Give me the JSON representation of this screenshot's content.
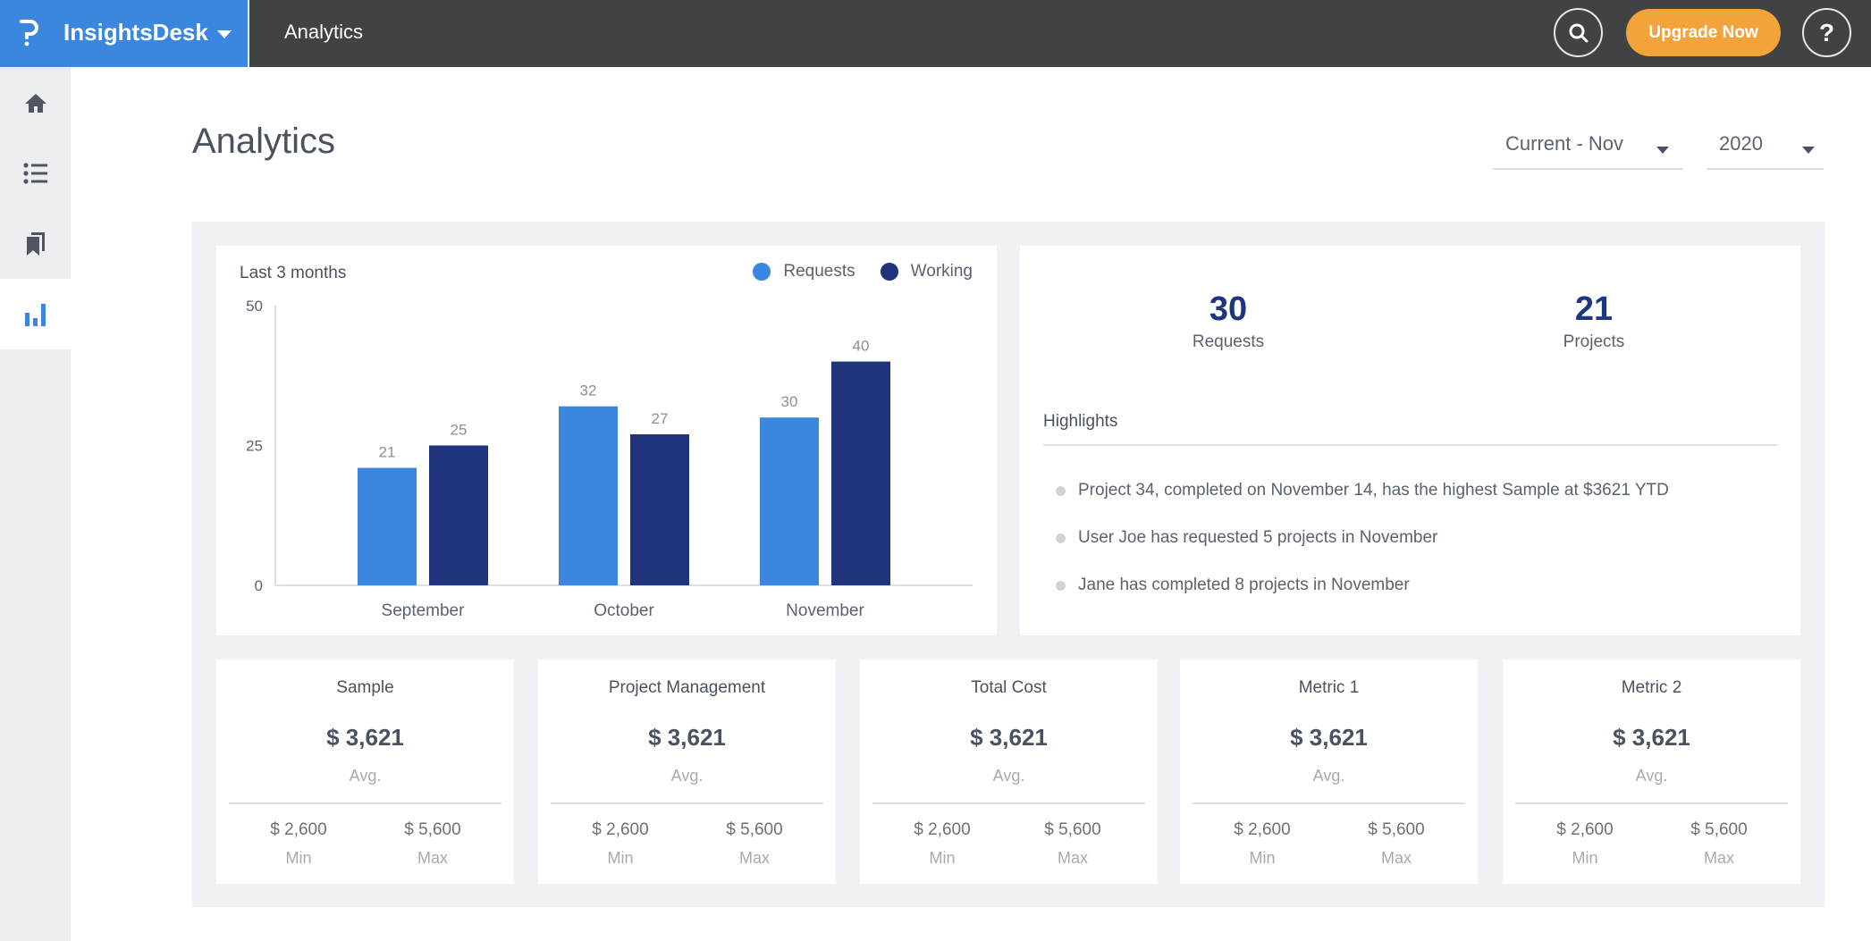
{
  "topbar": {
    "brand_name": "InsightsDesk",
    "section_title": "Analytics",
    "upgrade_label": "Upgrade Now",
    "help_label": "?",
    "icons": {
      "search": "search-icon",
      "help": "help-icon",
      "brand": "logo-icon",
      "brand_menu": "chevron-down-icon"
    }
  },
  "sidebar": {
    "items": [
      {
        "name": "home",
        "icon": "home-icon",
        "active": false
      },
      {
        "name": "list",
        "icon": "list-icon",
        "active": false
      },
      {
        "name": "bookmarks",
        "icon": "bookmarks-icon",
        "active": false
      },
      {
        "name": "analytics",
        "icon": "bar-chart-icon",
        "active": true
      }
    ]
  },
  "page": {
    "title": "Analytics",
    "period_select": {
      "value": "Current - Nov"
    },
    "year_select": {
      "value": "2020"
    }
  },
  "colors": {
    "brand": "#3b87e0",
    "topbar": "#414244",
    "upgrade": "#f2a43a",
    "requests": "#3b87e0",
    "working": "#1f347c",
    "stat_number": "#1f3580"
  },
  "chart_data": {
    "type": "bar",
    "title": "Last 3 months",
    "categories": [
      "September",
      "October",
      "November"
    ],
    "series": [
      {
        "name": "Requests",
        "color": "#3b87e0",
        "values": [
          21,
          32,
          30
        ]
      },
      {
        "name": "Working",
        "color": "#1f347c",
        "values": [
          25,
          27,
          40
        ]
      }
    ],
    "yticks": [
      0,
      25,
      50
    ],
    "ylim": [
      0,
      50
    ],
    "xlabel": "",
    "ylabel": "",
    "grid": false,
    "legend": "top-right"
  },
  "stats": [
    {
      "value": "30",
      "label": "Requests"
    },
    {
      "value": "21",
      "label": "Projects"
    }
  ],
  "highlights": {
    "title": "Highlights",
    "items": [
      "Project 34, completed on November 14, has the highest Sample at $3621 YTD",
      "User Joe has requested 5 projects in November",
      "Jane has completed 8 projects in November"
    ]
  },
  "metrics": [
    {
      "title": "Sample",
      "value": "$ 3,621",
      "avg_label": "Avg.",
      "min": "$ 2,600",
      "min_label": "Min",
      "max": "$ 5,600",
      "max_label": "Max"
    },
    {
      "title": "Project Management",
      "value": "$ 3,621",
      "avg_label": "Avg.",
      "min": "$ 2,600",
      "min_label": "Min",
      "max": "$ 5,600",
      "max_label": "Max"
    },
    {
      "title": "Total Cost",
      "value": "$ 3,621",
      "avg_label": "Avg.",
      "min": "$ 2,600",
      "min_label": "Min",
      "max": "$ 5,600",
      "max_label": "Max"
    },
    {
      "title": "Metric 1",
      "value": "$ 3,621",
      "avg_label": "Avg.",
      "min": "$ 2,600",
      "min_label": "Min",
      "max": "$ 5,600",
      "max_label": "Max"
    },
    {
      "title": "Metric 2",
      "value": "$ 3,621",
      "avg_label": "Avg.",
      "min": "$ 2,600",
      "min_label": "Min",
      "max": "$ 5,600",
      "max_label": "Max"
    }
  ]
}
